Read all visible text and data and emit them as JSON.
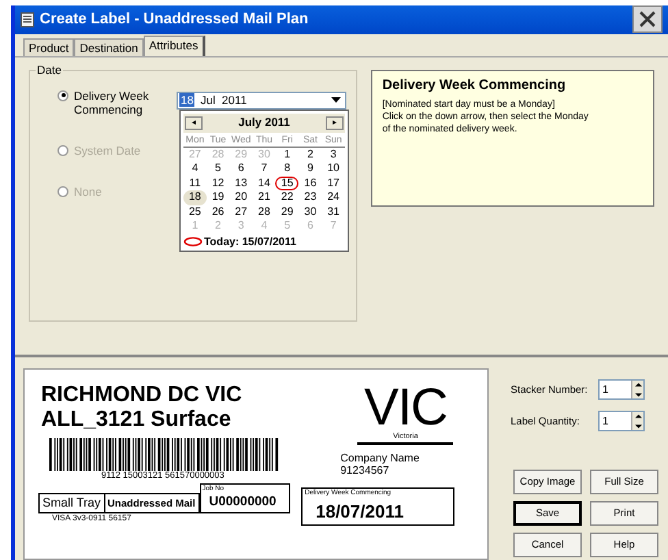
{
  "window": {
    "title": "Create Label - Unaddressed Mail Plan"
  },
  "tabs": [
    {
      "label": "Product",
      "selected": false
    },
    {
      "label": "Destination",
      "selected": false
    },
    {
      "label": "Attributes",
      "selected": true
    }
  ],
  "date_group": {
    "legend": "Date",
    "options": [
      {
        "label": "Delivery Week Commencing",
        "selected": true,
        "disabled": false
      },
      {
        "label": "System Date",
        "selected": false,
        "disabled": true
      },
      {
        "label": "None",
        "selected": false,
        "disabled": true
      }
    ],
    "date_field": {
      "day": "18",
      "rest": "Jul  2011"
    },
    "calendar": {
      "month": "July 2011",
      "prev": "◂",
      "next": "▸",
      "weekdays": [
        "Mon",
        "Tue",
        "Wed",
        "Thu",
        "Fri",
        "Sat",
        "Sun"
      ],
      "days": [
        {
          "day": "27",
          "muted": true,
          "selected": false
        },
        {
          "day": "28",
          "muted": true,
          "selected": false
        },
        {
          "day": "29",
          "muted": true,
          "selected": false
        },
        {
          "day": "30",
          "muted": true,
          "selected": false
        },
        {
          "day": "1",
          "muted": false,
          "selected": false
        },
        {
          "day": "2",
          "muted": false,
          "selected": false
        },
        {
          "day": "3",
          "muted": false,
          "selected": false
        },
        {
          "day": "4",
          "muted": false,
          "selected": false
        },
        {
          "day": "5",
          "muted": false,
          "selected": false
        },
        {
          "day": "6",
          "muted": false,
          "selected": false
        },
        {
          "day": "7",
          "muted": false,
          "selected": false
        },
        {
          "day": "8",
          "muted": false,
          "selected": false
        },
        {
          "day": "9",
          "muted": false,
          "selected": false
        },
        {
          "day": "10",
          "muted": false,
          "selected": false
        },
        {
          "day": "11",
          "muted": false,
          "selected": false
        },
        {
          "day": "12",
          "muted": false,
          "selected": false
        },
        {
          "day": "13",
          "muted": false,
          "selected": false
        },
        {
          "day": "14",
          "muted": false,
          "selected": false
        },
        {
          "day": "15",
          "muted": false,
          "selected": false,
          "today": true
        },
        {
          "day": "16",
          "muted": false,
          "selected": false
        },
        {
          "day": "17",
          "muted": false,
          "selected": false
        },
        {
          "day": "18",
          "muted": false,
          "selected": true
        },
        {
          "day": "19",
          "muted": false,
          "selected": false
        },
        {
          "day": "20",
          "muted": false,
          "selected": false
        },
        {
          "day": "21",
          "muted": false,
          "selected": false
        },
        {
          "day": "22",
          "muted": false,
          "selected": false
        },
        {
          "day": "23",
          "muted": false,
          "selected": false
        },
        {
          "day": "24",
          "muted": false,
          "selected": false
        },
        {
          "day": "25",
          "muted": false,
          "selected": false
        },
        {
          "day": "26",
          "muted": false,
          "selected": false
        },
        {
          "day": "27",
          "muted": false,
          "selected": false
        },
        {
          "day": "28",
          "muted": false,
          "selected": false
        },
        {
          "day": "29",
          "muted": false,
          "selected": false
        },
        {
          "day": "30",
          "muted": false,
          "selected": false
        },
        {
          "day": "31",
          "muted": false,
          "selected": false
        },
        {
          "day": "1",
          "muted": true,
          "selected": false
        },
        {
          "day": "2",
          "muted": true,
          "selected": false
        },
        {
          "day": "3",
          "muted": true,
          "selected": false
        },
        {
          "day": "4",
          "muted": true,
          "selected": false
        },
        {
          "day": "5",
          "muted": true,
          "selected": false
        },
        {
          "day": "6",
          "muted": true,
          "selected": false
        },
        {
          "day": "7",
          "muted": true,
          "selected": false
        }
      ],
      "today": "Today: 15/07/2011"
    }
  },
  "help": {
    "title": "Delivery Week Commencing",
    "lines": [
      "[Nominated start day must be a Monday]",
      "Click on the down arrow, then select the Monday",
      "of the nominated delivery week."
    ]
  },
  "label": {
    "line_1": "RICHMOND DC VIC",
    "line_2": "ALL_3121 Surface",
    "state": "VIC",
    "state_name": "Victoria",
    "company": "Company Name",
    "company_number": "91234567",
    "barcode_number": "9112 15003121 561570000003",
    "tray": "Small Tray",
    "mail_type": "Unaddressed Mail",
    "job_caption": "Job No",
    "job_no": "U00000000",
    "week_caption": "Delivery Week Commencing",
    "week_date": "18/07/2011",
    "footer": "VISA 3v3-0911 56157"
  },
  "spinners": [
    {
      "label": "Stacker Number:",
      "value": "1"
    },
    {
      "label": "Label Quantity:",
      "value": "1"
    }
  ],
  "buttons": [
    {
      "label": "Copy Image",
      "default": false
    },
    {
      "label": "Full Size",
      "default": false
    },
    {
      "label": "Save",
      "default": true
    },
    {
      "label": "Print",
      "default": false
    },
    {
      "label": "Cancel",
      "default": false
    },
    {
      "label": "Help",
      "default": false
    }
  ]
}
